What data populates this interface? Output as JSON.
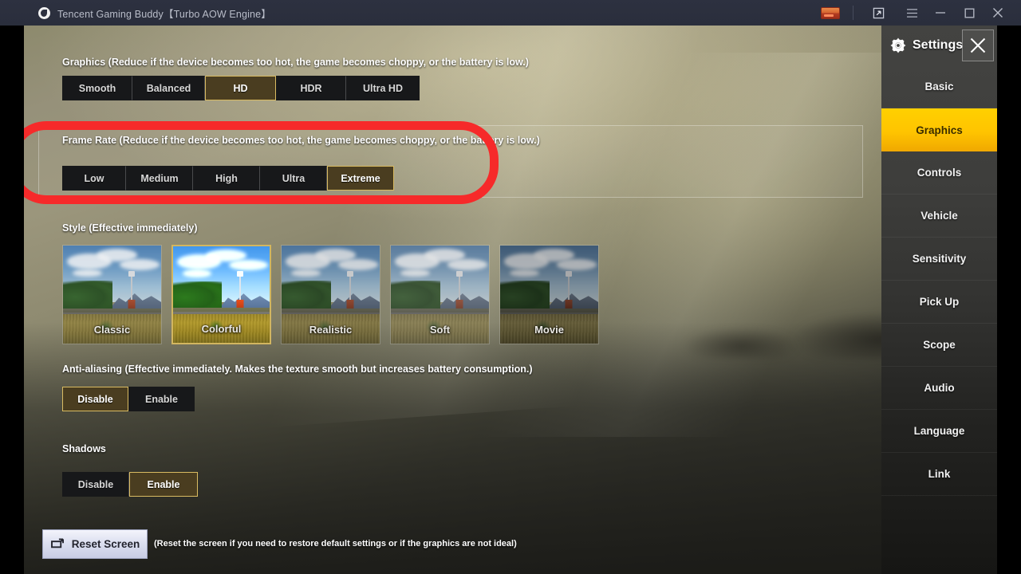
{
  "window": {
    "title": "Tencent Gaming Buddy【Turbo AOW Engine】",
    "controls": {
      "banner_icon": "card-icon",
      "expand_label": "expand-icon",
      "menu_label": "hamburger-menu-icon",
      "minimize_label": "minimize-icon",
      "maximize_label": "maximize-icon",
      "close_label": "close-icon"
    }
  },
  "sidebar": {
    "title": "Settings",
    "gear_icon": "gear-icon",
    "close_icon": "close-icon",
    "items": [
      {
        "label": "Basic",
        "active": false
      },
      {
        "label": "Graphics",
        "active": true
      },
      {
        "label": "Controls",
        "active": false
      },
      {
        "label": "Vehicle",
        "active": false
      },
      {
        "label": "Sensitivity",
        "active": false
      },
      {
        "label": "Pick Up",
        "active": false
      },
      {
        "label": "Scope",
        "active": false
      },
      {
        "label": "Audio",
        "active": false
      },
      {
        "label": "Language",
        "active": false
      },
      {
        "label": "Link",
        "active": false
      }
    ],
    "accent_color": "#ffc400"
  },
  "settings": {
    "graphics": {
      "label": "Graphics (Reduce if the device becomes too hot, the game becomes choppy, or the battery is low.)",
      "options": [
        "Smooth",
        "Balanced",
        "HD",
        "HDR",
        "Ultra HD"
      ],
      "widths": [
        88,
        91,
        89,
        88,
        92
      ],
      "selected": "HD"
    },
    "frame_rate": {
      "label": "Frame Rate (Reduce if the device becomes too hot, the game becomes choppy, or the battery is low.)",
      "options": [
        "Low",
        "Medium",
        "High",
        "Ultra",
        "Extreme"
      ],
      "widths": [
        80,
        84,
        84,
        84,
        84
      ],
      "selected": "Extreme",
      "highlighted": true
    },
    "style": {
      "label": "Style (Effective immediately)",
      "options": [
        {
          "label": "Classic",
          "grade": "g-classic",
          "selected": false
        },
        {
          "label": "Colorful",
          "grade": "g-colorful",
          "selected": true
        },
        {
          "label": "Realistic",
          "grade": "g-realistic",
          "selected": false
        },
        {
          "label": "Soft",
          "grade": "g-soft",
          "selected": false
        },
        {
          "label": "Movie",
          "grade": "g-movie",
          "selected": false
        }
      ],
      "selected": "Colorful"
    },
    "anti_aliasing": {
      "label": "Anti-aliasing (Effective immediately. Makes the texture smooth but increases battery consumption.)",
      "options": [
        "Disable",
        "Enable"
      ],
      "widths": [
        83,
        83
      ],
      "selected": "Disable"
    },
    "shadows": {
      "label": "Shadows",
      "options": [
        "Disable",
        "Enable"
      ],
      "widths": [
        84,
        86
      ],
      "selected": "Enable"
    },
    "reset": {
      "button_label": "Reset Screen",
      "icon": "reset-arrow-icon",
      "note": "(Reset the screen if you need to restore default settings or if the graphics are not ideal)"
    }
  },
  "annotation": {
    "type": "red-rounded-rectangle",
    "color": "#f62a2a",
    "targets": "frame-rate-section"
  }
}
